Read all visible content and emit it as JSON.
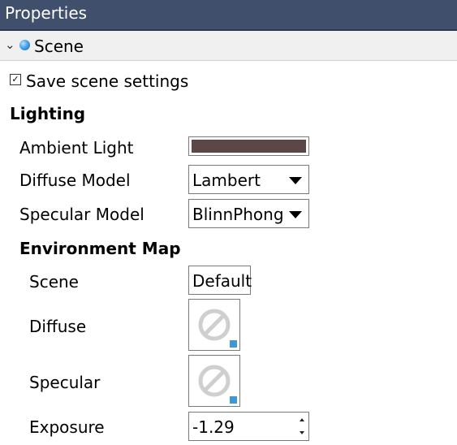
{
  "panel": {
    "title": "Properties"
  },
  "section": {
    "title": "Scene",
    "icon": "globe-icon",
    "expand_icon": "chevron-down-icon"
  },
  "save_settings": {
    "label": "Save scene settings",
    "checked": true
  },
  "lighting": {
    "heading": "Lighting",
    "ambient": {
      "label": "Ambient Light",
      "color": "#5b4745"
    },
    "diffuse": {
      "label": "Diffuse Model",
      "value": "Lambert"
    },
    "specular": {
      "label": "Specular Model",
      "value": "BlinnPhong"
    }
  },
  "env_map": {
    "heading": "Environment Map",
    "scene": {
      "label": "Scene",
      "value": "Default"
    },
    "diffuse": {
      "label": "Diffuse",
      "icon": "no-texture-icon"
    },
    "specular": {
      "label": "Specular",
      "icon": "no-texture-icon"
    },
    "exposure": {
      "label": "Exposure",
      "value": "-1.29"
    }
  }
}
